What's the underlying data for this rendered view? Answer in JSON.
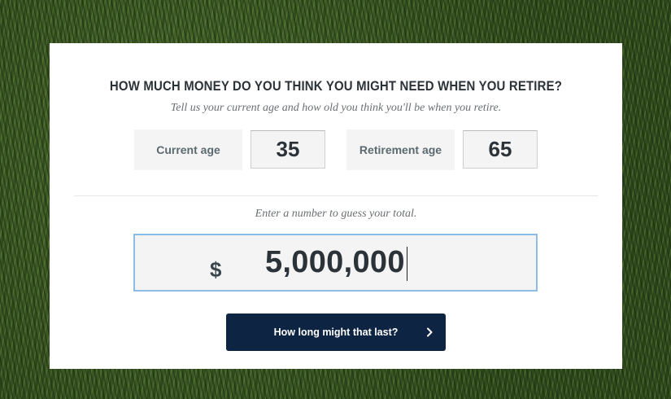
{
  "calculator": {
    "title": "HOW MUCH MONEY DO YOU THINK YOU MIGHT NEED WHEN YOU RETIRE?",
    "subtitle": "Tell us your current age and how old you think you'll be when you retire.",
    "current_age": {
      "label": "Current age",
      "value": "35"
    },
    "retirement_age": {
      "label": "Retirement age",
      "value": "65"
    },
    "total_hint": "Enter a number to guess your total.",
    "total": {
      "currency_symbol": "$",
      "value": "5,000,000"
    },
    "submit": {
      "label": "How long might that last?",
      "icon": "chevron-right-icon"
    }
  },
  "colors": {
    "button_bg": "#0e2443",
    "input_focus_border": "#8dbde6",
    "field_bg": "#f4f4f5",
    "title_text": "#2c3338"
  }
}
